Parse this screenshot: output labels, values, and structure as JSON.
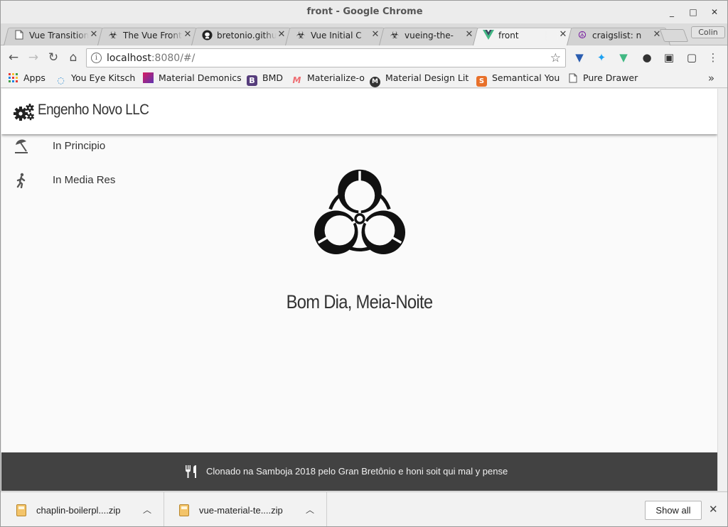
{
  "window": {
    "title": "front - Google Chrome",
    "controls": [
      "_",
      "□",
      "✕"
    ]
  },
  "tabs": [
    {
      "label": "Vue Transitions",
      "icon": "page-icon"
    },
    {
      "label": "The Vue Front",
      "icon": "biohazard-icon"
    },
    {
      "label": "bretonio.github",
      "icon": "github-icon"
    },
    {
      "label": "Vue Initial C",
      "icon": "biohazard-icon"
    },
    {
      "label": "vueing-the-",
      "icon": "biohazard-icon"
    },
    {
      "label": "front",
      "icon": "vue-icon",
      "active": true
    },
    {
      "label": "craigslist: n",
      "icon": "peace-icon"
    }
  ],
  "profile": "Colin",
  "omnibox": {
    "host": "localhost",
    "rest": ":8080/#/"
  },
  "bookmarks": [
    {
      "label": "Apps",
      "icon": "apps-grid-icon"
    },
    {
      "label": "You Eye Kitsch",
      "icon": "spinner-icon"
    },
    {
      "label": "Material Demonics",
      "icon": "gradient-square-icon"
    },
    {
      "label": "BMD",
      "icon": "bootstrap-icon"
    },
    {
      "label": "Materialize-o",
      "icon": "materialize-icon"
    },
    {
      "label": "Material Design Lite",
      "icon": "m-circle-icon"
    },
    {
      "label": "Semantical You",
      "icon": "semantic-icon"
    },
    {
      "label": "Pure Drawer",
      "icon": "page-icon"
    }
  ],
  "app": {
    "brand": "Engenho Novo LLC",
    "drawer": [
      {
        "label": "In Principio",
        "icon": "umbrella-beach-icon"
      },
      {
        "label": "In Media Res",
        "icon": "walking-person-icon"
      }
    ],
    "hero_text": "Bom Dia, Meia-Noite",
    "footer_text": "Clonado na Samboja 2018 pelo Gran Bretônio e honi soit qui mal y pense"
  },
  "downloads": {
    "items": [
      {
        "filename": "chaplin-boilerpl....zip"
      },
      {
        "filename": "vue-material-te....zip"
      }
    ],
    "show_all": "Show all"
  },
  "colors": {
    "footer_bg": "#424242",
    "page_bg": "#fafafa",
    "vue_green": "#41b883"
  }
}
